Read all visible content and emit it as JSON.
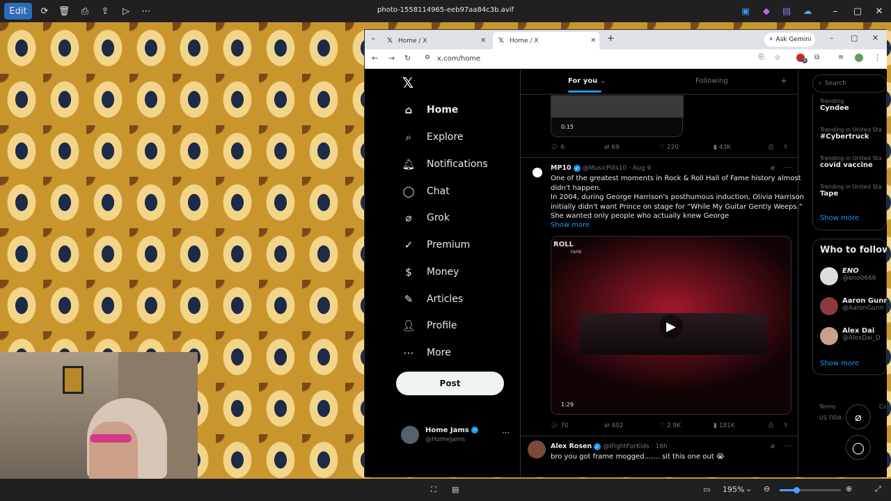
{
  "viewer": {
    "edit_label": "Edit",
    "title": "photo-1558114965-eeb97aa84c3b.avif",
    "zoom": "195%"
  },
  "browser": {
    "tabs": [
      {
        "label": "Home / X"
      },
      {
        "label": "Home / X"
      }
    ],
    "gemini_label": "Ask Gemini",
    "url": "x.com/home",
    "ext_badge": "1"
  },
  "x": {
    "nav": [
      {
        "label": "Home",
        "icon": "home-icon"
      },
      {
        "label": "Explore",
        "icon": "search-icon"
      },
      {
        "label": "Notifications",
        "icon": "bell-icon"
      },
      {
        "label": "Chat",
        "icon": "chat-icon"
      },
      {
        "label": "Grok",
        "icon": "grok-icon"
      },
      {
        "label": "Premium",
        "icon": "premium-icon"
      },
      {
        "label": "Money",
        "icon": "money-icon"
      },
      {
        "label": "Articles",
        "icon": "articles-icon"
      },
      {
        "label": "Profile",
        "icon": "profile-icon"
      },
      {
        "label": "More",
        "icon": "more-icon"
      }
    ],
    "post_label": "Post",
    "account": {
      "name": "Home Jams",
      "handle": "@HomeJams"
    },
    "tabs": {
      "for_you": "For you",
      "following": "Following"
    },
    "tweet0": {
      "duration": "0:15",
      "replies": "6",
      "reposts": "69",
      "likes": "220",
      "views": "43K"
    },
    "tweet1": {
      "name": "MP10",
      "handle": "@MusicPills10",
      "date": "· Aug 9",
      "line1": "One of the greatest moments in Rock & Roll Hall of Fame history almost",
      "line2": "didn't happen.",
      "line3": "In 2004, during George Harrison's posthumous induction, Olivia Harrison",
      "line4": "initially didn't want Prince on stage for “While My Guitar Gently Weeps.”",
      "line5": "She wanted only people who actually knew George",
      "show_more": "Show more",
      "video_overlay": "ROLL",
      "video_overlay2": "FAME",
      "duration": "1:29",
      "replies": "70",
      "reposts": "402",
      "likes": "2.9K",
      "views": "181K"
    },
    "tweet2": {
      "name": "Alex Rosen",
      "handle": "@IFightForKids",
      "date": "· 16h",
      "text": "bro you got frame mogged....... sit this one out 😭"
    },
    "search_placeholder": "Search",
    "trends": [
      {
        "context": "Trending",
        "topic": "Cyndee"
      },
      {
        "context": "Trending in United Sta",
        "topic": "#Cybertruck"
      },
      {
        "context": "Trending in United Sta",
        "topic": "covid vaccine"
      },
      {
        "context": "Trending in United Sta",
        "topic": "Tape"
      }
    ],
    "show_more": "Show more",
    "wtf_title": "Who to follow",
    "follow": [
      {
        "name": "ENO",
        "handle": "@eno0666"
      },
      {
        "name": "Aaron Gunn",
        "handle": "@AaronGunn"
      },
      {
        "name": "Alex Dai",
        "handle": "@AlexDai_D"
      }
    ],
    "follow_show_more": "Show more",
    "footer": {
      "terms": "Terms",
      "region": "US TIDA",
      "cookie": "Coo"
    }
  },
  "colors": {
    "accent": "#1d9bf0",
    "x_bg": "#000000",
    "viewer_bg": "#202020"
  }
}
